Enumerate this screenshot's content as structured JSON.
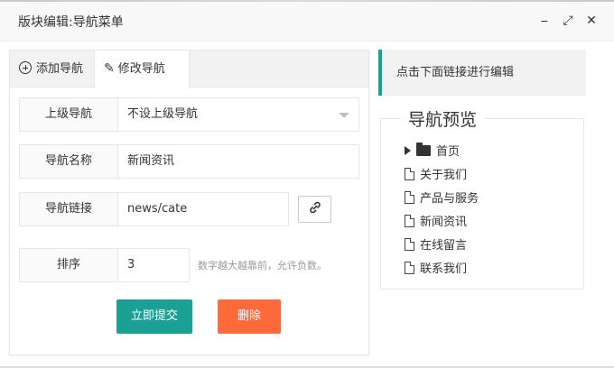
{
  "window": {
    "title": "版块编辑:导航菜单",
    "min_glyph": "⎯",
    "max_glyph": "⤢",
    "close_glyph": "✕"
  },
  "tabs": [
    {
      "label": "添加导航",
      "icon": "plus-circle-icon"
    },
    {
      "label": "修改导航",
      "icon": "pencil-icon"
    }
  ],
  "form": {
    "parent": {
      "label": "上级导航",
      "value": "不设上级导航"
    },
    "name": {
      "label": "导航名称",
      "value": "新闻资讯"
    },
    "link": {
      "label": "导航链接",
      "value": "news/cate"
    },
    "order": {
      "label": "排序",
      "value": "3",
      "hint": "数字越大越靠前，允许负数。"
    }
  },
  "buttons": {
    "submit": "立即提交",
    "delete": "删除"
  },
  "note": "点击下面链接进行编辑",
  "preview": {
    "legend": "导航预览",
    "root": "首页",
    "children": [
      "关于我们",
      "产品与服务",
      "新闻资讯",
      "在线留言",
      "联系我们"
    ]
  },
  "colors": {
    "accent": "#1aa094",
    "danger": "#ff6a3b"
  }
}
